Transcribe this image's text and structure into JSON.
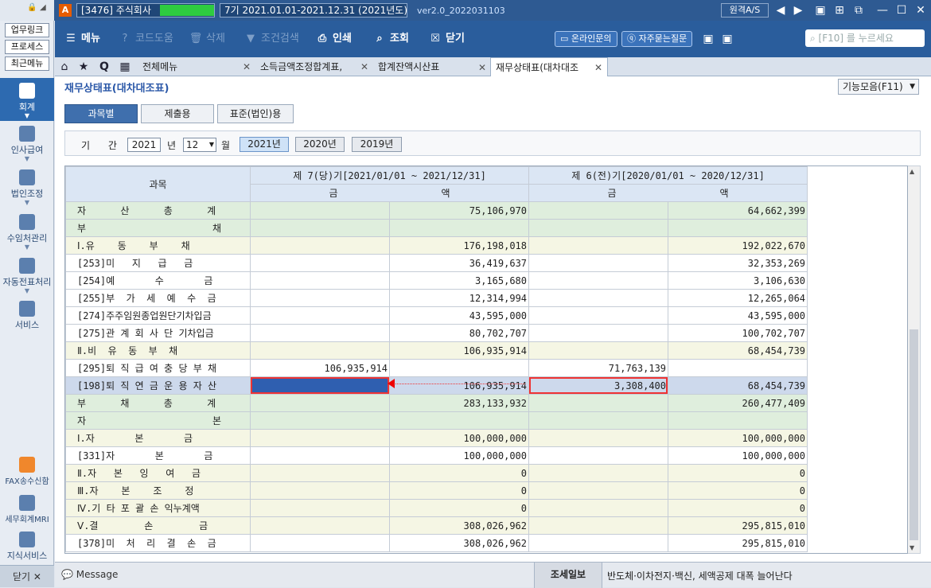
{
  "window": {
    "company": "[3476] 주식회사",
    "period": "7기  2021.01.01-2021.12.31  (2021년도)",
    "version": "ver2.0_2022031103",
    "remote": "원격A/S"
  },
  "leftbar": {
    "quick": [
      "업무링크",
      "프로세스",
      "최근메뉴"
    ],
    "items": [
      "회계",
      "인사급여",
      "법인조정",
      "수임처관리",
      "자동전표처리",
      "서비스"
    ],
    "bottom": [
      "FAX송수신함",
      "세무회계MRI",
      "지식서비스"
    ],
    "close": "닫기 ✕"
  },
  "toolbar": {
    "menu": "메뉴",
    "code": "코드도움",
    "delete": "삭제",
    "condsearch": "조건검색",
    "print": "인쇄",
    "lookup": "조회",
    "close": "닫기",
    "online": "온라인문의",
    "faq": "자주묻는질문",
    "search_placeholder": "[F10] 를 누르세요"
  },
  "tabs": {
    "all": "전체메뉴",
    "t1": "소득금액조정합계표,",
    "t2": "합계잔액시산표",
    "t3": "재무상태표(대차대조"
  },
  "page": {
    "title": "재무상태표(대차대조표)",
    "func": "기능모음(F11)",
    "subtabs": [
      "과목별",
      "제출용",
      "표준(법인)용"
    ],
    "period_label": "기      간",
    "year": "2021",
    "year_unit": "년",
    "month": "12",
    "month_unit": "월",
    "year_buttons": [
      "2021년",
      "2020년",
      "2019년"
    ]
  },
  "grid": {
    "col_account": "과목",
    "cur_period": "제 7(당)기[2021/01/01 ~ 2021/12/31]",
    "prev_period": "제 6(전)기[2020/01/01 ~ 2020/12/31]",
    "amount": "금                  액",
    "rows": [
      {
        "name": "자      산      총      계",
        "a": "",
        "b": "75,106,970",
        "c": "",
        "d": "64,662,399",
        "style": "green"
      },
      {
        "name": "부                      채",
        "a": "",
        "b": "",
        "c": "",
        "d": "",
        "style": "green"
      },
      {
        "name": "Ⅰ.유    동    부    채",
        "a": "",
        "b": "176,198,018",
        "c": "",
        "d": "192,022,670",
        "style": "cream"
      },
      {
        "name": "[253]미   지   급   금",
        "a": "",
        "b": "36,419,637",
        "c": "",
        "d": "32,353,269",
        "style": "white"
      },
      {
        "name": "[254]예       수       금",
        "a": "",
        "b": "3,165,680",
        "c": "",
        "d": "3,106,630",
        "style": "white"
      },
      {
        "name": "[255]부  가  세  예  수  금",
        "a": "",
        "b": "12,314,994",
        "c": "",
        "d": "12,265,064",
        "style": "white"
      },
      {
        "name": "[274]주주임원종업원단기차입금",
        "a": "",
        "b": "43,595,000",
        "c": "",
        "d": "43,595,000",
        "style": "white"
      },
      {
        "name": "[275]관 계 회 사 단 기차입금",
        "a": "",
        "b": "80,702,707",
        "c": "",
        "d": "100,702,707",
        "style": "white"
      },
      {
        "name": "Ⅱ.비  유  동  부  채",
        "a": "",
        "b": "106,935,914",
        "c": "",
        "d": "68,454,739",
        "style": "cream"
      },
      {
        "name": "[295]퇴 직 급 여 충 당 부 채",
        "a": "106,935,914",
        "b": "",
        "c": "71,763,139",
        "d": "",
        "style": "white"
      },
      {
        "name": "[198]퇴 직 연 금 운 용 자 산",
        "a": "",
        "b": "106,935,914",
        "c": "3,308,400",
        "d": "68,454,739",
        "style": "selrow"
      },
      {
        "name": "부      채      총      계",
        "a": "",
        "b": "283,133,932",
        "c": "",
        "d": "260,477,409",
        "style": "green"
      },
      {
        "name": "자                      본",
        "a": "",
        "b": "",
        "c": "",
        "d": "",
        "style": "green"
      },
      {
        "name": "Ⅰ.자       본       금",
        "a": "",
        "b": "100,000,000",
        "c": "",
        "d": "100,000,000",
        "style": "cream"
      },
      {
        "name": "[331]자       본       금",
        "a": "",
        "b": "100,000,000",
        "c": "",
        "d": "100,000,000",
        "style": "white"
      },
      {
        "name": "Ⅱ.자   본   잉   여   금",
        "a": "",
        "b": "0",
        "c": "",
        "d": "0",
        "style": "cream"
      },
      {
        "name": "Ⅲ.자    본    조    정",
        "a": "",
        "b": "0",
        "c": "",
        "d": "0",
        "style": "cream"
      },
      {
        "name": "Ⅳ.기 타 포 괄 손 익누계액",
        "a": "",
        "b": "0",
        "c": "",
        "d": "0",
        "style": "cream"
      },
      {
        "name": "Ⅴ.결        손        금",
        "a": "",
        "b": "308,026,962",
        "c": "",
        "d": "295,815,010",
        "style": "cream"
      },
      {
        "name": "[378]미  처  리  결  손  금",
        "a": "",
        "b": "308,026,962",
        "c": "",
        "d": "295,815,010",
        "style": "white"
      }
    ]
  },
  "status": {
    "message": "Message",
    "news_label": "조세일보",
    "news": "반도체·이차전지·백신, 세액공제 대폭 늘어난다"
  }
}
